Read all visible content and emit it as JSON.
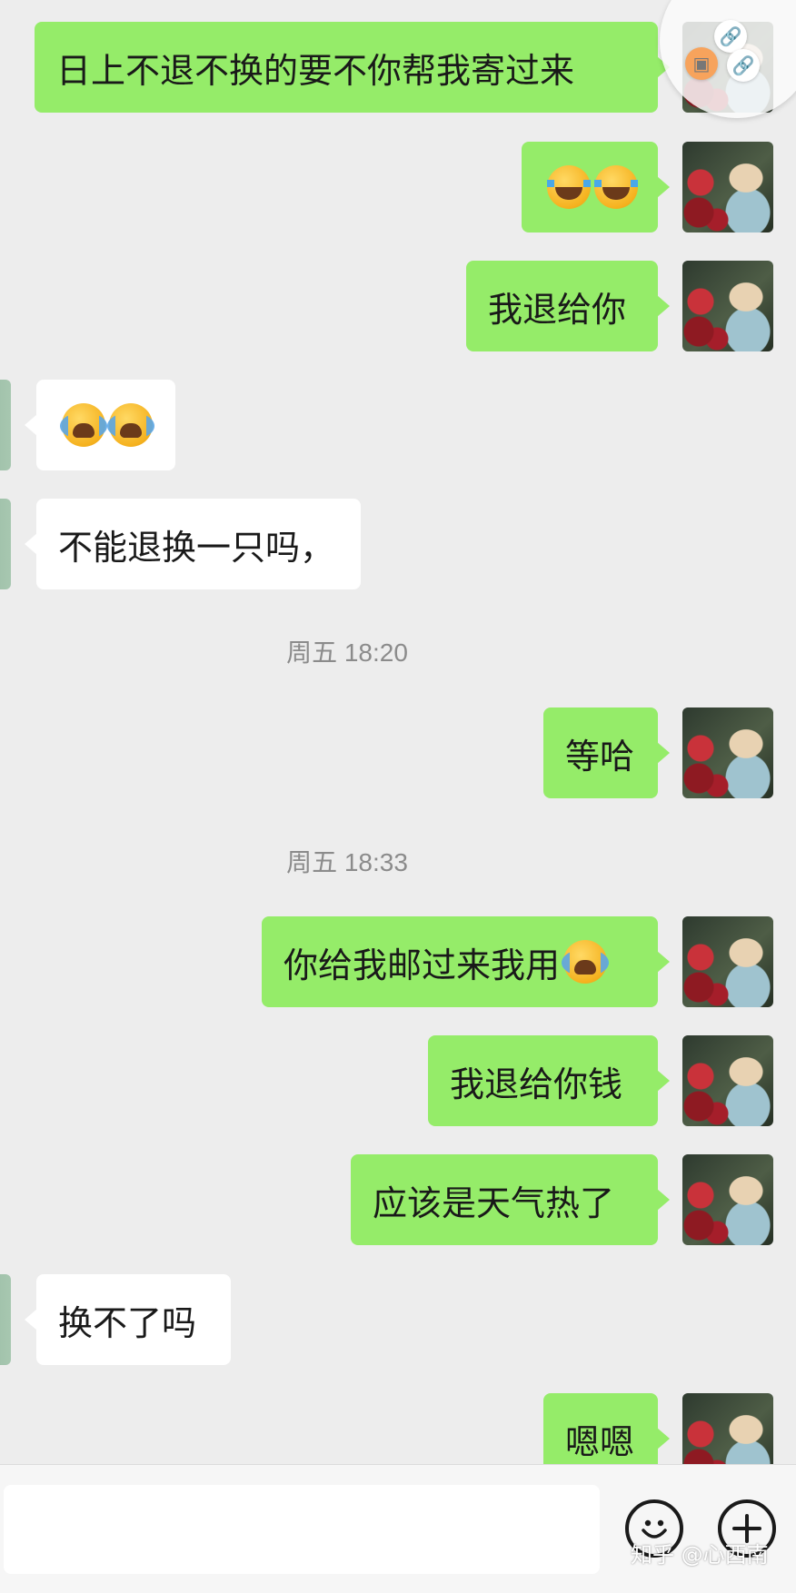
{
  "timestamps": [
    "周五 18:20",
    "周五 18:33"
  ],
  "messages": [
    {
      "side": "out",
      "text": "日上不退不换的要不你帮我寄过来"
    },
    {
      "side": "out",
      "text": "",
      "emoji": [
        "laugh-tears-emoji",
        "laugh-tears-emoji"
      ]
    },
    {
      "side": "out",
      "text": "我退给你"
    },
    {
      "side": "in",
      "text": "",
      "emoji": [
        "crying-emoji",
        "crying-emoji"
      ]
    },
    {
      "side": "in",
      "text": "不能退换一只吗，"
    },
    {
      "side": "out",
      "text": "等哈"
    },
    {
      "side": "out",
      "text": "你给我邮过来我用",
      "emoji": [
        "crying-emoji"
      ]
    },
    {
      "side": "out",
      "text": "我退给你钱"
    },
    {
      "side": "out",
      "text": "应该是天气热了"
    },
    {
      "side": "in",
      "text": "换不了吗"
    },
    {
      "side": "out",
      "text": "嗯嗯"
    }
  ],
  "input": {
    "placeholder": ""
  },
  "icons": {
    "emoji_button": "smiley-icon",
    "more_button": "plus-icon",
    "floating_ball": "link-icon"
  },
  "watermark": "知乎 @心西南",
  "colors": {
    "outgoing_bubble": "#95ec69",
    "incoming_bubble": "#ffffff",
    "background": "#ededed"
  }
}
